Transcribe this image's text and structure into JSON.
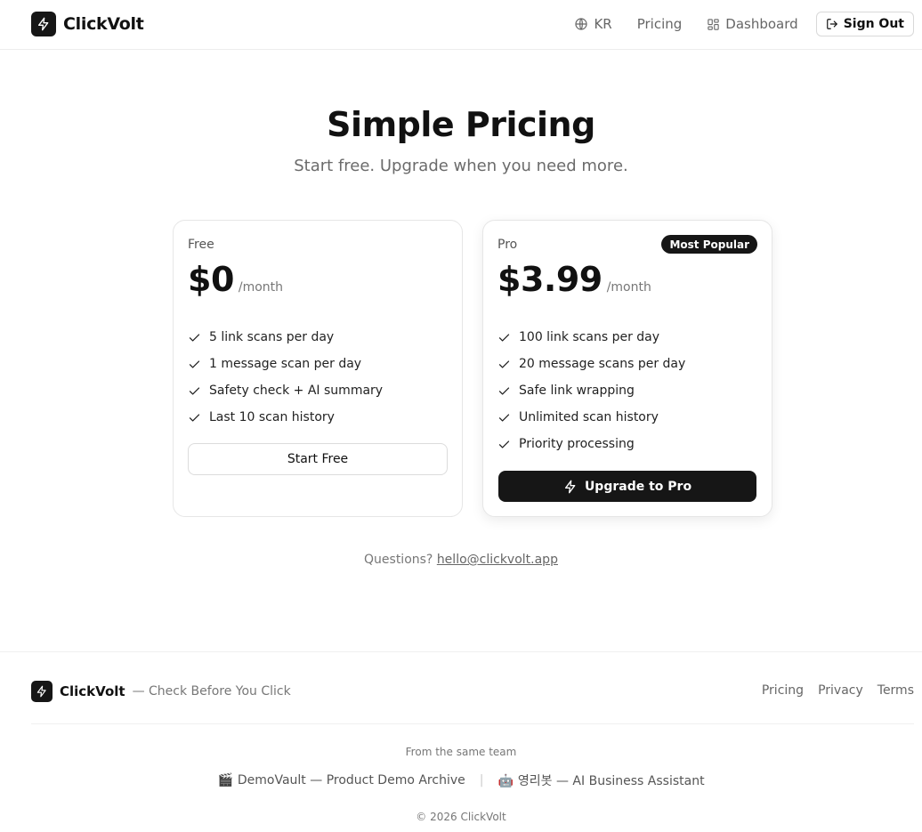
{
  "header": {
    "brand": "ClickVolt",
    "nav": {
      "language": "KR",
      "pricing": "Pricing",
      "dashboard": "Dashboard",
      "sign_out": "Sign Out"
    }
  },
  "hero": {
    "title": "Simple Pricing",
    "subtitle": "Start free. Upgrade when you need more."
  },
  "plans": [
    {
      "name": "Free",
      "price": "$0",
      "period": "/month",
      "features": [
        "5 link scans per day",
        "1 message scan per day",
        "Safety check + AI summary",
        "Last 10 scan history"
      ],
      "cta": "Start Free"
    },
    {
      "name": "Pro",
      "badge": "Most Popular",
      "price": "$3.99",
      "period": "/month",
      "features": [
        "100 link scans per day",
        "20 message scans per day",
        "Safe link wrapping",
        "Unlimited scan history",
        "Priority processing"
      ],
      "cta": "Upgrade to Pro"
    }
  ],
  "contact": {
    "prefix": "Questions?",
    "email": "hello@clickvolt.app"
  },
  "footer": {
    "brand": "ClickVolt",
    "tagline": "— Check Before You Click",
    "links": [
      "Pricing",
      "Privacy",
      "Terms"
    ],
    "same_team_label": "From the same team",
    "sister_products": [
      {
        "emoji": "🎬",
        "label": "DemoVault — Product Demo Archive"
      },
      {
        "emoji": "🤖",
        "label": "영리봇 — AI Business Assistant"
      }
    ],
    "separator": "|",
    "copyright": "© 2026 ClickVolt"
  },
  "colors": {
    "accent": "#161616",
    "text_muted": "#6b6b6b",
    "border": "#e6e6e6"
  },
  "icons": {
    "brand": "lightning-icon",
    "language": "globe-icon",
    "dashboard": "grid-icon",
    "sign_out": "logout-icon",
    "feature": "check-icon"
  }
}
